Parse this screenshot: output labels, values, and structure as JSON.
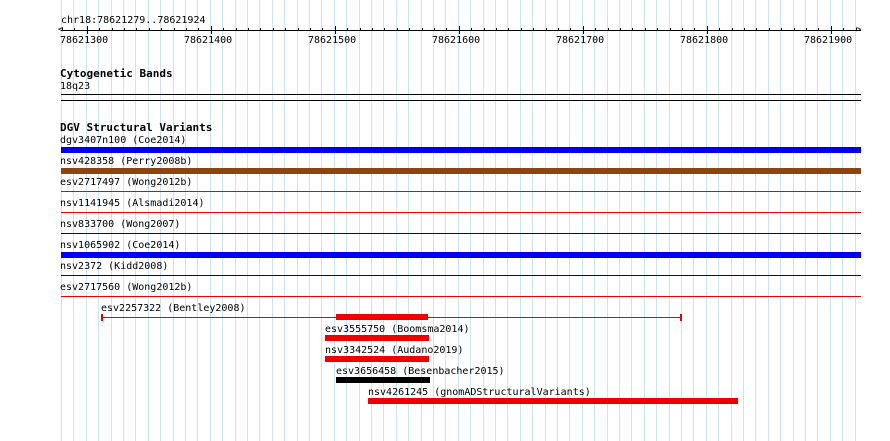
{
  "region": "chr18:78621279..78621924",
  "ruler": {
    "labels": [
      "78621300",
      "78621400",
      "78621500",
      "78621600",
      "78621700",
      "78621800",
      "78621900"
    ]
  },
  "cytobands": {
    "title": "Cytogenetic Bands",
    "band": "18q23"
  },
  "dgv": {
    "title": "DGV Structural Variants",
    "tracks": [
      {
        "label": "dgv3407n100 (Coe2014)",
        "color": "#0000ee"
      },
      {
        "label": "nsv428358 (Perry2008b)",
        "color": "#8b4513"
      },
      {
        "label": "esv2717497 (Wong2012b)",
        "color": "#ee0000"
      },
      {
        "label": "nsv1141945 (Alsmadi2014)",
        "color": "#ee0000"
      },
      {
        "label": "nsv833700 (Wong2007)",
        "color": "#00008b"
      },
      {
        "label": "nsv1065902 (Coe2014)",
        "color": "#0000ee"
      },
      {
        "label": "nsv2372 (Kidd2008)",
        "color": "#00008b"
      },
      {
        "label": "esv2717560 (Wong2012b)",
        "color": "#ee0000"
      }
    ],
    "features": [
      {
        "label": "esv2257322 (Bentley2008)",
        "color": "#ee0000"
      },
      {
        "label": "esv3555750 (Boomsma2014)",
        "color": "#ee0000"
      },
      {
        "label": "nsv3342524 (Audano2019)",
        "color": "#ee0000"
      },
      {
        "label": "esv3656458 (Besenbacher2015)",
        "color": "#000000"
      },
      {
        "label": "nsv4261245 (gnomADStructuralVariants)",
        "color": "#ee0000"
      }
    ]
  }
}
